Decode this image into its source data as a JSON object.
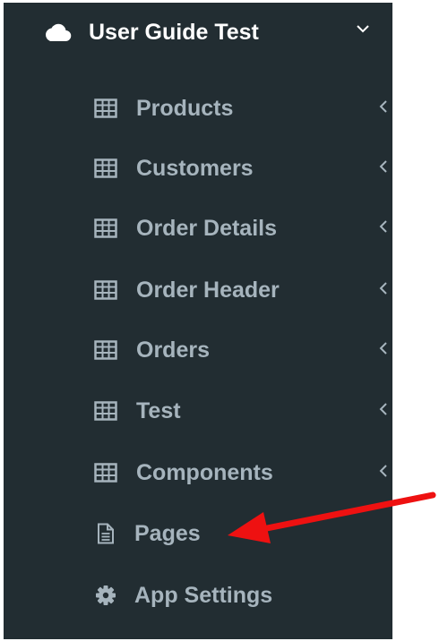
{
  "app": {
    "title": "User Guide Test",
    "icon": "cloud-icon",
    "expand_icon": "chevron-down-icon"
  },
  "menu": {
    "items": [
      {
        "label": "Products",
        "icon": "table-icon",
        "has_submenu": true
      },
      {
        "label": "Customers",
        "icon": "table-icon",
        "has_submenu": true
      },
      {
        "label": "Order Details",
        "icon": "table-icon",
        "has_submenu": true
      },
      {
        "label": "Order Header",
        "icon": "table-icon",
        "has_submenu": true
      },
      {
        "label": "Orders",
        "icon": "table-icon",
        "has_submenu": true
      },
      {
        "label": "Test",
        "icon": "table-icon",
        "has_submenu": true
      },
      {
        "label": "Components",
        "icon": "table-icon",
        "has_submenu": true
      },
      {
        "label": "Pages",
        "icon": "document-icon",
        "has_submenu": false
      },
      {
        "label": "App Settings",
        "icon": "gear-icon",
        "has_submenu": false
      }
    ]
  },
  "annotation": {
    "type": "arrow",
    "color": "#ee1111",
    "points_to": "Pages"
  },
  "colors": {
    "sidebar_bg": "#222d32",
    "header_text": "#ffffff",
    "item_text": "#a6b4bd"
  }
}
